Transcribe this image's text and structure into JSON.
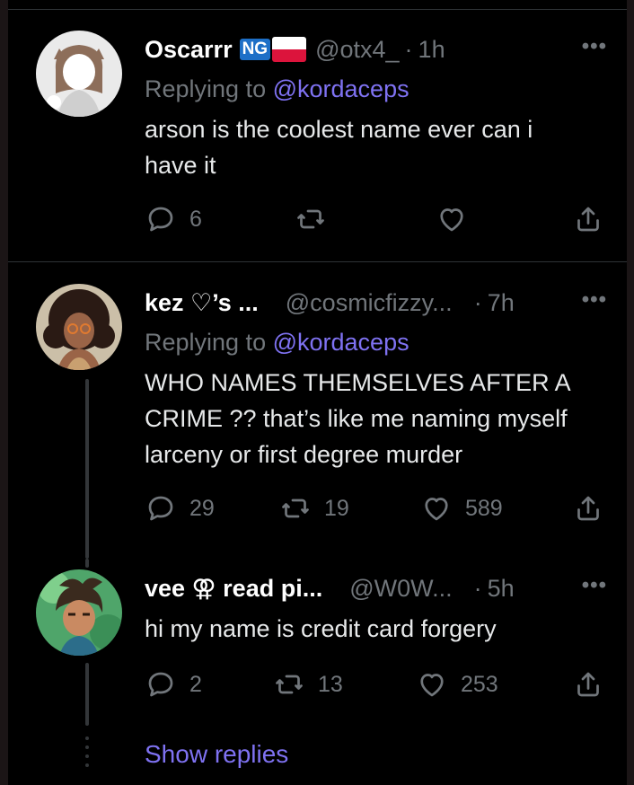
{
  "tweets": [
    {
      "name": "Oscarrr",
      "badge": "NG",
      "handle": "@otx4_",
      "dot": "·",
      "time": "1h",
      "replying_prefix": "Replying to",
      "replying_to": "@kordaceps",
      "text": "arson is the coolest name ever can i have it",
      "reply_count": "6",
      "retweet_count": "",
      "like_count": ""
    },
    {
      "name": "kez ♡’s ...",
      "handle": "@cosmicfizzy...",
      "dot": "·",
      "time": "7h",
      "replying_prefix": "Replying to",
      "replying_to": "@kordaceps",
      "text": "WHO NAMES THEMSELVES AFTER A CRIME ?? that’s like me naming myself larceny or first degree murder",
      "reply_count": "29",
      "retweet_count": "19",
      "like_count": "589"
    },
    {
      "name": "vee ⚢ read pi...",
      "handle": "@W0W...",
      "dot": "·",
      "time": "5h",
      "text": "hi my name is credit card forgery",
      "reply_count": "2",
      "retweet_count": "13",
      "like_count": "253"
    }
  ],
  "more_icon": "more-horizontal-icon",
  "show_replies": "Show replies",
  "colors": {
    "background": "#000000",
    "text": "#e7e9ea",
    "secondary": "#71767b",
    "accent": "#7f72f2",
    "divider": "#2f3336"
  }
}
